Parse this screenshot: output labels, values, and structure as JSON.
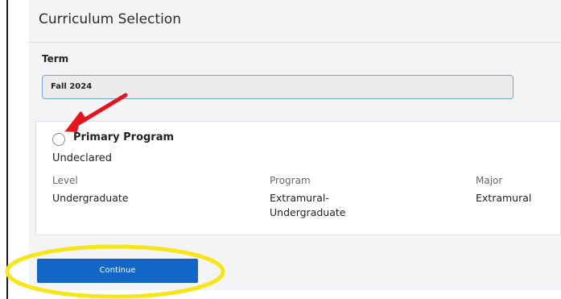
{
  "header": {
    "title": "Curriculum Selection"
  },
  "term": {
    "label": "Term",
    "value": "Fall 2024"
  },
  "program_card": {
    "heading": "Primary Program",
    "status": "Undeclared",
    "columns": [
      {
        "label": "Level",
        "value": "Undergraduate"
      },
      {
        "label": "Program",
        "value": "Extramural-\nUndergraduate"
      },
      {
        "label": "Major",
        "value": "Extramural"
      }
    ]
  },
  "actions": {
    "continue_label": "Continue"
  },
  "annotations": {
    "arrow_color": "#e8141b",
    "highlight_color": "#f7e617"
  },
  "colors": {
    "primary_button": "#1466c6",
    "field_border": "#6fa8d6",
    "panel_bg": "#f4f4f6"
  }
}
